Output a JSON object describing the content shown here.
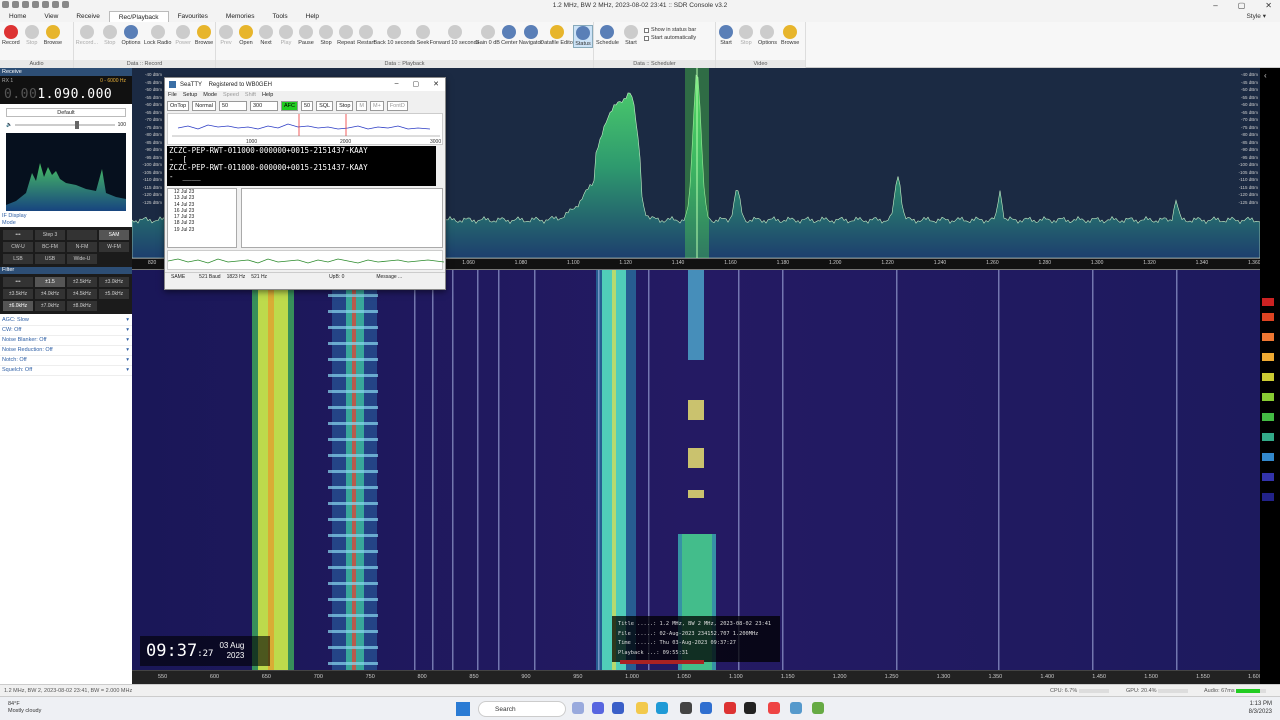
{
  "window": {
    "title": "1.2 MHz, BW 2 MHz, 2023-08-02 23:41 :: SDR Console v3.2",
    "style_label": "Style"
  },
  "menu": [
    "Home",
    "View",
    "Receive",
    "Rec/Playback",
    "Favourites",
    "Memories",
    "Tools",
    "Help"
  ],
  "ribbon": {
    "audio": {
      "label": "Audio",
      "buttons": [
        "Record",
        "Stop",
        "Browse"
      ]
    },
    "data_record": {
      "label": "Data :: Record",
      "buttons": [
        "Record...",
        "Stop",
        "Options",
        "Lock Radio",
        "Power",
        "Browse"
      ]
    },
    "data_playback": {
      "label": "Data :: Playback",
      "buttons": [
        "Prev",
        "Open",
        "Next",
        "Play",
        "Pause",
        "Stop",
        "Repeat",
        "Restart",
        "Back 10 seconds",
        "Seek",
        "Forward 10 seconds",
        "Gain 0 dB",
        "Center",
        "Navigator",
        "Datafile Editor",
        "Status"
      ]
    },
    "data_scheduler": {
      "label": "Data :: Scheduler",
      "buttons": [
        "Schedule",
        "Start"
      ],
      "checks": [
        "Show in status bar",
        "Start automatically"
      ]
    },
    "video": {
      "label": "Video",
      "buttons": [
        "Start",
        "Stop",
        "Options",
        "Browse"
      ]
    }
  },
  "left_panel": {
    "header": "Receive",
    "rx_label": "RX 1",
    "range": "0 - 6000 Hz",
    "freq_dim": "0.00",
    "freq_main": "1.090.000",
    "preset": "Default",
    "volume_max": "100",
    "if_display": "IF Display",
    "mode_label": "Mode",
    "modes": [
      "•••",
      "Step 3",
      "",
      "SAM",
      "CW-U",
      "BC-FM",
      "N-FM",
      "W-FM",
      "LSB",
      "USB",
      "Wide-U"
    ],
    "filter_label": "Filter",
    "filters": [
      "•••",
      "±1.5",
      "±2.5kHz",
      "±3.0kHz",
      "±3.5kHz",
      "±4.0kHz",
      "±4.5kHz",
      "±5.0kHz",
      "±6.0kHz",
      "±7.0kHz",
      "±8.0kHz"
    ],
    "options": [
      "AGC: Slow",
      "CW: Off",
      "Noise Blanker: Off",
      "Noise Reduction: Off",
      "Notch: Off",
      "Squelch: Off"
    ]
  },
  "spectrum": {
    "db_labels": [
      "-40 dBm",
      "-45 dBm",
      "-50 dBm",
      "-55 dBm",
      "-60 dBm",
      "-65 dBm",
      "-70 dBm",
      "-75 dBm",
      "-80 dBm",
      "-85 dBm",
      "-90 dBm",
      "-95 dBm",
      "-100 dBm",
      "-105 dBm",
      "-110 dBm",
      "-115 dBm",
      "-120 dBm",
      "-125 dBm"
    ],
    "top_ticks": [
      "820",
      "900",
      "980",
      "1.000",
      "1.020",
      "1.040",
      "1.060",
      "1.080",
      "1.100",
      "1.120",
      "1.140",
      "1.160",
      "1.180",
      "1.200",
      "1.220",
      "1.240",
      "1.260",
      "1.280",
      "1.300",
      "1.320",
      "1.340",
      "1.360"
    ],
    "bottom_ticks": [
      "550",
      "600",
      "650",
      "700",
      "750",
      "800",
      "850",
      "900",
      "950",
      "1.000",
      "1.050",
      "1.100",
      "1.150",
      "1.200",
      "1.250",
      "1.300",
      "1.350",
      "1.400",
      "1.450",
      "1.500",
      "1.550",
      "1.600"
    ]
  },
  "seatty": {
    "title": "SeaTTY    Registered to WB0GEH",
    "menu": [
      "File",
      "Setup",
      "Mode",
      "Speed",
      "Shift",
      "Help"
    ],
    "toolbar": [
      "OnTop",
      "Normal",
      "50",
      "300",
      "AFC",
      "50",
      "SQL",
      "Stop",
      "M",
      "M+",
      "FontD"
    ],
    "scale": [
      "1000",
      "2000",
      "3000"
    ],
    "decoded": "ZCZC-PEP-RWT-011000-000000+0015-2151437-KAAY\n-  [\nZCZC-PEP-RWT-011000-000000+0015-2151437-KAAY\n-  ____",
    "dates": [
      "12 Jul 23",
      "13 Jul 23",
      "14 Jul 23",
      "16 Jul 23",
      "17 Jul 23",
      "18 Jul 23",
      "19 Jul 23"
    ],
    "status": [
      "SAME",
      "521 Baud",
      "1823 Hz",
      "521 Hz",
      "UpB: 0",
      "Message ..."
    ]
  },
  "clock": {
    "time": "09:37",
    "seconds": ":27",
    "day": "03 Aug",
    "year": "2023"
  },
  "playback_info": {
    "title_line": "Title .....: 1.2 MHz, BW 2 MHz, 2023-08-02 23:41",
    "file_line": "File ......: 02-Aug-2023 234152.707 1.200MHz",
    "time_line": "Time ......: Thu 03-Aug-2023 09:37:27",
    "playback_line": "Playback ...: 09:55:31"
  },
  "statusbar": {
    "left": "1.2 MHz, BW 2, 2023-08-02 23:41, BW = 2.000 MHz",
    "cpu": "CPU: 6.7%",
    "gpu": "GPU: 20.4%",
    "audio": "Audio: 67ms"
  },
  "taskbar": {
    "temp": "84°F",
    "weather": "Mostly cloudy",
    "search": "Search",
    "time": "1:13 PM",
    "date": "8/3/2023"
  },
  "colors": {
    "accent": "#2d4e75",
    "waterfall": "#1f1a60",
    "spectrum_fill": "#2fae6e"
  }
}
